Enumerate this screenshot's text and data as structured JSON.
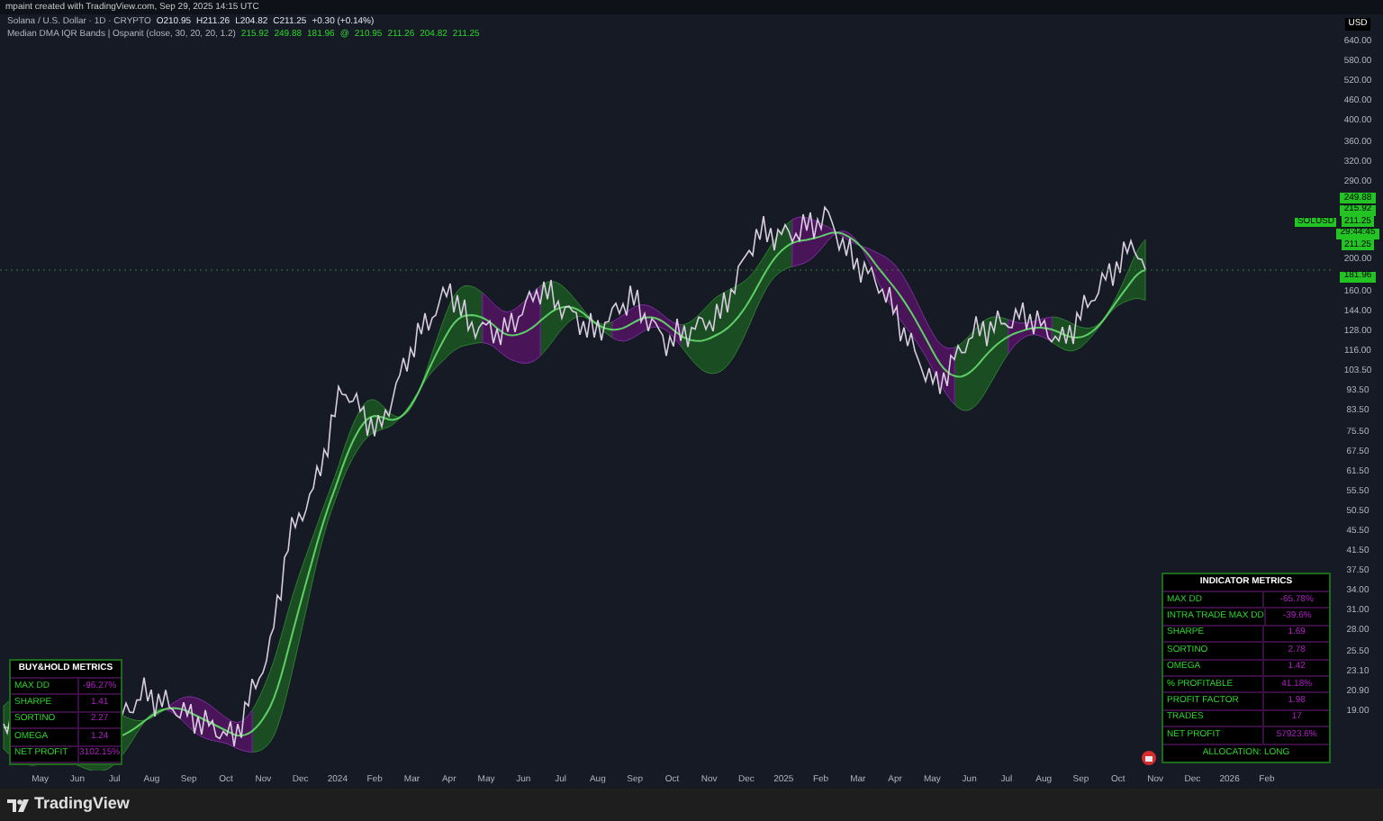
{
  "attribution": "mpaint created with TradingView.com, Sep 29, 2025 14:15 UTC",
  "legend": {
    "symbol": "Solana / U.S. Dollar · 1D · CRYPTO",
    "ohlc": [
      "O210.95",
      "H211.26",
      "L204.82",
      "C211.25"
    ],
    "change": "+0.30 (+0.14%)",
    "indicator": "Median DMA IQR Bands | Ospanit (close, 30, 20, 20, 1.2)",
    "values": [
      "215.92",
      "249.88",
      "181.96",
      "@",
      "210.95",
      "211.26",
      "204.82",
      "211.25"
    ]
  },
  "price_axis": {
    "currency": "USD",
    "items": [
      {
        "kind": "tick",
        "label": "640.00"
      },
      {
        "kind": "tick",
        "label": "580.00"
      },
      {
        "kind": "tick",
        "label": "520.00"
      },
      {
        "kind": "tick",
        "label": "460.00"
      },
      {
        "kind": "tick",
        "label": "400.00"
      },
      {
        "kind": "tick",
        "label": "360.00"
      },
      {
        "kind": "tick",
        "label": "320.00"
      },
      {
        "kind": "tick",
        "label": "290.00"
      },
      {
        "kind": "badge",
        "label": "249.88"
      },
      {
        "kind": "badge",
        "label": "215.92"
      },
      {
        "kind": "badge",
        "label": "211.25",
        "tag": "SOLUSD"
      },
      {
        "kind": "badge",
        "label": "29:44:45"
      },
      {
        "kind": "badge",
        "label": "211.25"
      },
      {
        "kind": "tick",
        "label": "200.00"
      },
      {
        "kind": "badge",
        "label": "181.96"
      },
      {
        "kind": "tick",
        "label": "160.00"
      },
      {
        "kind": "tick",
        "label": "144.00"
      },
      {
        "kind": "tick",
        "label": "128.00"
      },
      {
        "kind": "tick",
        "label": "116.00"
      },
      {
        "kind": "tick",
        "label": "103.50"
      },
      {
        "kind": "tick",
        "label": "93.50"
      },
      {
        "kind": "tick",
        "label": "83.50"
      },
      {
        "kind": "tick",
        "label": "75.50"
      },
      {
        "kind": "tick",
        "label": "67.50"
      },
      {
        "kind": "tick",
        "label": "61.50"
      },
      {
        "kind": "tick",
        "label": "55.50"
      },
      {
        "kind": "tick",
        "label": "50.50"
      },
      {
        "kind": "tick",
        "label": "45.50"
      },
      {
        "kind": "tick",
        "label": "41.50"
      },
      {
        "kind": "tick",
        "label": "37.50"
      },
      {
        "kind": "tick",
        "label": "34.00"
      },
      {
        "kind": "tick",
        "label": "31.00"
      },
      {
        "kind": "tick",
        "label": "28.00"
      },
      {
        "kind": "tick",
        "label": "25.50"
      },
      {
        "kind": "tick",
        "label": "23.10"
      },
      {
        "kind": "tick",
        "label": "20.90"
      },
      {
        "kind": "tick",
        "label": "19.00"
      }
    ]
  },
  "time_axis": [
    "May",
    "Jun",
    "Jul",
    "Aug",
    "Sep",
    "Oct",
    "Nov",
    "Dec",
    "2024",
    "Feb",
    "Mar",
    "Apr",
    "May",
    "Jun",
    "Jul",
    "Aug",
    "Sep",
    "Oct",
    "Nov",
    "Dec",
    "2025",
    "Feb",
    "Mar",
    "Apr",
    "May",
    "Jun",
    "Jul",
    "Aug",
    "Sep",
    "Oct",
    "Nov",
    "Dec",
    "2026",
    "Feb"
  ],
  "buy_hold_table": {
    "title": "BUY&HOLD METRICS",
    "rows": [
      {
        "label": "MAX DD",
        "value": "-96.27%"
      },
      {
        "label": "SHARPE",
        "value": "1.41"
      },
      {
        "label": "SORTINO",
        "value": "2.27"
      },
      {
        "label": "OMEGA",
        "value": "1.24"
      },
      {
        "label": "NET PROFIT",
        "value": "3102.15%"
      }
    ]
  },
  "indicator_table": {
    "title": "INDICATOR METRICS",
    "rows": [
      {
        "label": "MAX DD",
        "value": "-65.78%"
      },
      {
        "label": "INTRA TRADE MAX DD",
        "value": "-39.6%"
      },
      {
        "label": "SHARPE",
        "value": "1.69"
      },
      {
        "label": "SORTINO",
        "value": "2.78"
      },
      {
        "label": "OMEGA",
        "value": "1.42"
      },
      {
        "label": "% PROFITABLE",
        "value": "41.18%"
      },
      {
        "label": "PROFIT FACTOR",
        "value": "1.98"
      },
      {
        "label": "TRADES",
        "value": "17"
      },
      {
        "label": "NET PROFIT",
        "value": "57923.6%"
      }
    ],
    "footer": "ALLOCATION: LONG"
  },
  "footer": {
    "brand": "TradingView"
  }
}
